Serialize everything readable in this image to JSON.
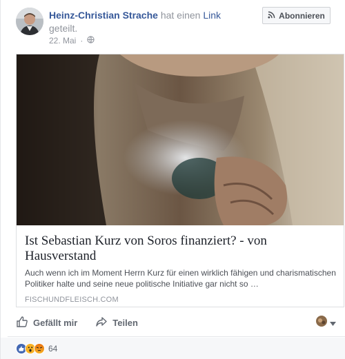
{
  "post": {
    "author": "Heinz-Christian Strache",
    "action_text": "hat einen",
    "link_word": "Link",
    "action_suffix": "geteilt.",
    "date": "22. Mai",
    "separator": "·",
    "follow_label": "Abonnieren"
  },
  "attachment": {
    "title": "Ist Sebastian Kurz von Soros finanziert? - von Hausverstand",
    "description": "Auch wenn ich im Moment Herrn Kurz für einen wirklich fähigen und charismatischen Politiker halte und seine neue politische Initiative gar nicht so …",
    "domain": "FISCHUNDFLEISCH.COM"
  },
  "actions": {
    "like_label": "Gefällt mir",
    "share_label": "Teilen"
  },
  "reactions": {
    "count": "64",
    "types": [
      "like-icon",
      "wow-icon",
      "angry-icon"
    ]
  },
  "colors": {
    "link_blue": "#365899",
    "like_blue": "#4267b2",
    "reaction_yellow": "#f7b125",
    "angry_red": "#e9710f"
  }
}
